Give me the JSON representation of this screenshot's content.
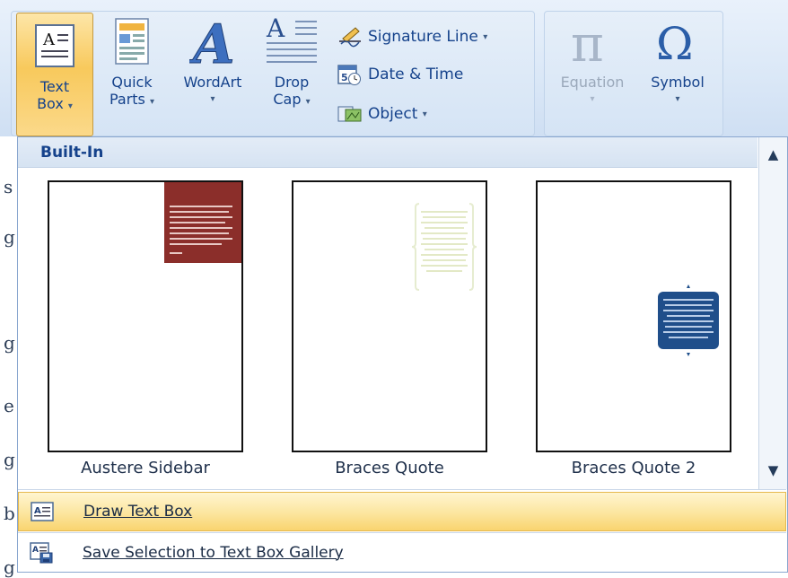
{
  "ribbon": {
    "text_box": {
      "line1": "Text",
      "line2": "Box",
      "caret": "▾"
    },
    "quick_parts": {
      "line1": "Quick",
      "line2": "Parts",
      "caret": "▾"
    },
    "wordart": {
      "label": "WordArt",
      "caret": "▾"
    },
    "drop_cap": {
      "line1": "Drop",
      "line2": "Cap",
      "caret": "▾"
    },
    "signature_line": {
      "label": "Signature Line",
      "caret": "▾"
    },
    "date_time": {
      "label": "Date & Time"
    },
    "object": {
      "label": "Object",
      "caret": "▾"
    },
    "equation": {
      "label": "Equation",
      "caret": "▾"
    },
    "symbol": {
      "label": "Symbol",
      "caret": "▾"
    }
  },
  "gallery": {
    "section_header": "Built-In",
    "items": [
      {
        "label": "Austere Sidebar",
        "accent": "#8b2e2a"
      },
      {
        "label": "Braces Quote",
        "accent": "#e9efcf"
      },
      {
        "label": "Braces Quote 2",
        "accent": "#1f4e8a"
      }
    ]
  },
  "menu": {
    "draw_text_box": "Draw Text Box",
    "save_selection": "Save Selection to Text Box Gallery"
  },
  "document": {
    "edge_chars": [
      "s",
      "g",
      "g",
      "e",
      "g",
      "b",
      "g"
    ]
  },
  "colors": {
    "ribbon_text": "#15428b",
    "pressed": "#f8c95c",
    "hover": "#fce7a3"
  }
}
